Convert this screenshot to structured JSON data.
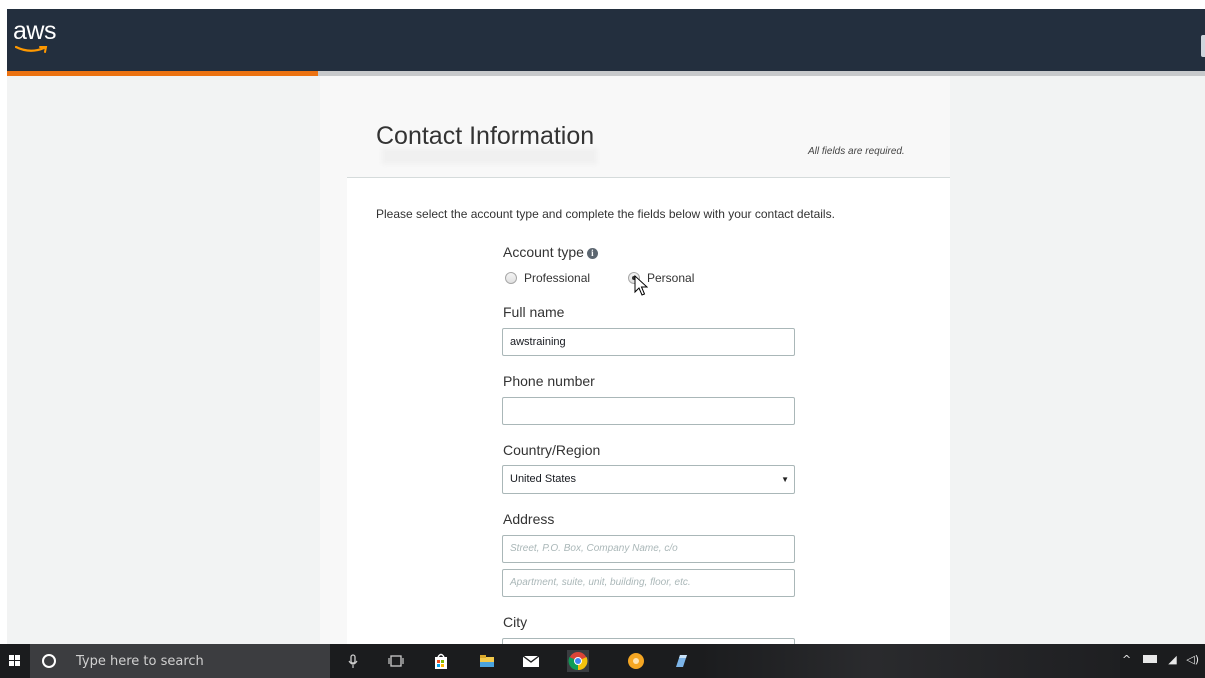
{
  "header": {
    "logo_text": "aws",
    "brand_color": "#232f3e",
    "accent_color": "#ec7211"
  },
  "progress": {
    "percent": 26
  },
  "form": {
    "title": "Contact Information",
    "required_note": "All fields are required.",
    "intro": "Please select the account type and complete the fields below with your contact details.",
    "account_type": {
      "label": "Account type",
      "options": [
        "Professional",
        "Personal"
      ],
      "selected": "Personal"
    },
    "full_name": {
      "label": "Full name",
      "value": "awstraining"
    },
    "phone": {
      "label": "Phone number",
      "value": ""
    },
    "country": {
      "label": "Country/Region",
      "value": "United States"
    },
    "address": {
      "label": "Address",
      "line1_placeholder": "Street, P.O. Box, Company Name, c/o",
      "line2_placeholder": "Apartment, suite, unit, building, floor, etc."
    },
    "city": {
      "label": "City"
    }
  },
  "taskbar": {
    "search_placeholder": "Type here to search",
    "icons": [
      "windows-start-icon",
      "cortana-icon",
      "microphone-icon",
      "task-view-icon",
      "store-icon",
      "file-explorer-icon",
      "mail-icon",
      "chrome-icon",
      "photos-app-icon",
      "pen-tablet-icon"
    ],
    "tray_icons": [
      "chevron-up-icon",
      "battery-icon",
      "wifi-icon",
      "volume-icon"
    ]
  }
}
